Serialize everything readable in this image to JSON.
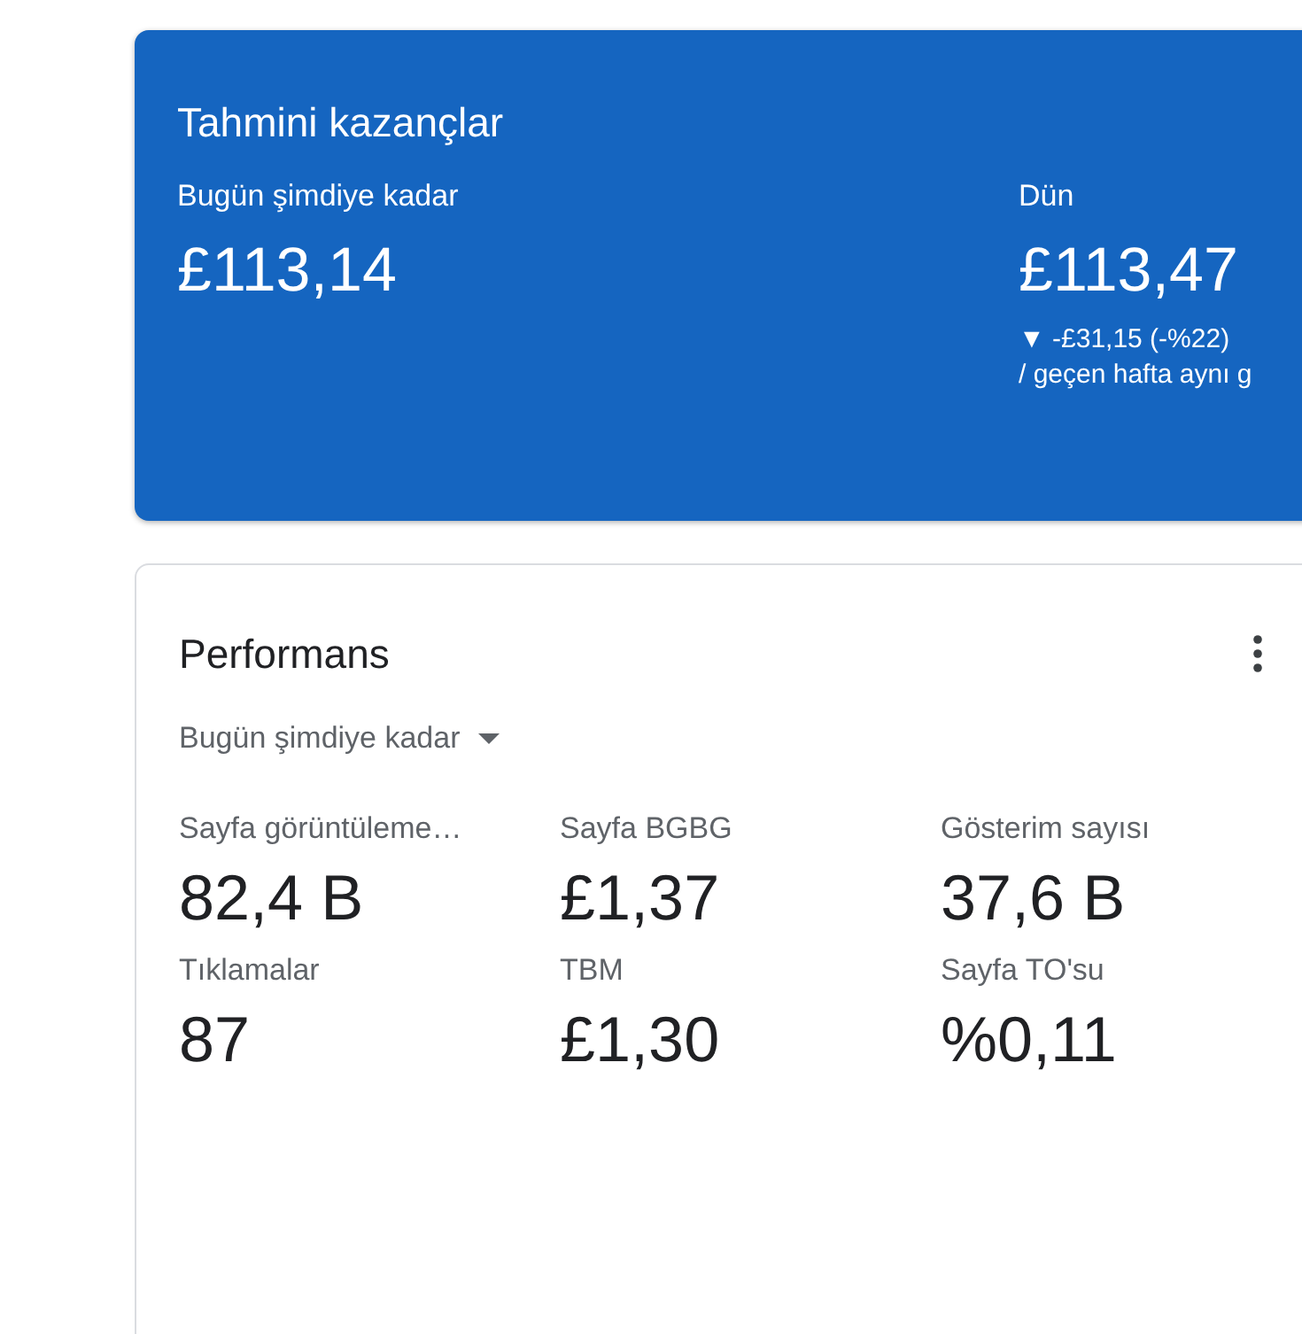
{
  "earnings_card": {
    "title": "Tahmini kazançlar",
    "columns": [
      {
        "label": "Bugün şimdiye kadar",
        "value": "£113,14"
      },
      {
        "label": "Dün",
        "value": "£113,47",
        "change": {
          "arrow": "▼",
          "text": "-£31,15 (-%22)"
        },
        "comparison": "/ geçen hafta aynı g"
      }
    ]
  },
  "performance_card": {
    "title": "Performans",
    "period": "Bugün şimdiye kadar",
    "metrics": [
      {
        "label": "Sayfa görüntüleme…",
        "value": "82,4 B"
      },
      {
        "label": "Sayfa BGBG",
        "value": "£1,37"
      },
      {
        "label": "Gösterim sayısı",
        "value": "37,6 B"
      },
      {
        "label": "Tıklamalar",
        "value": "87"
      },
      {
        "label": "TBM",
        "value": "£1,30"
      },
      {
        "label": "Sayfa TO'su",
        "value": "%0,11"
      }
    ]
  }
}
